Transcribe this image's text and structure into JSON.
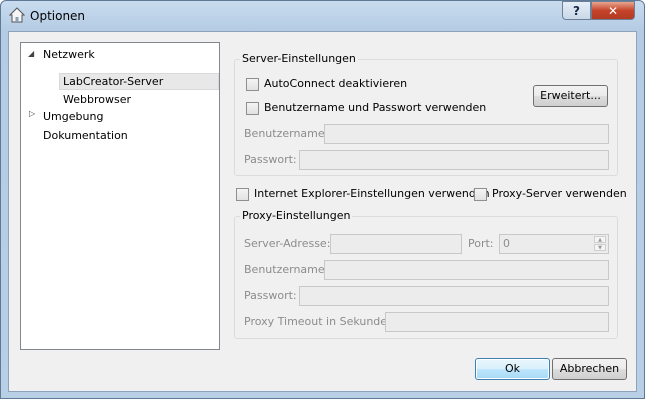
{
  "window": {
    "title": "Optionen",
    "help_label": "?",
    "close_label": "✕"
  },
  "tree": {
    "items": [
      {
        "label": "Netzwerk",
        "expanded": true
      },
      {
        "label": "LabCreator-Server",
        "selected": true
      },
      {
        "label": "Webbrowser"
      },
      {
        "label": "Umgebung",
        "expanded": false
      },
      {
        "label": "Dokumentation"
      }
    ]
  },
  "server": {
    "group_title": "Server-Einstellungen",
    "autoconnect_label": "AutoConnect deaktivieren",
    "autoconnect_checked": false,
    "credentials_label": "Benutzername und Passwort verwenden",
    "credentials_checked": false,
    "advanced_button": "Erweitert...",
    "username_label": "Benutzername:",
    "username_value": "",
    "password_label": "Passwort:",
    "password_value": ""
  },
  "ie_settings": {
    "label": "Internet Explorer-Einstellungen verwenden",
    "checked": false
  },
  "proxy_server": {
    "label": "Proxy-Server verwenden",
    "checked": false
  },
  "proxy": {
    "group_title": "Proxy-Einstellungen",
    "address_label": "Server-Adresse:",
    "address_value": "",
    "port_label": "Port:",
    "port_value": "0",
    "username_label": "Benutzername:",
    "username_value": "",
    "password_label": "Passwort:",
    "password_value": "",
    "timeout_label": "Proxy Timeout in Sekunden:",
    "timeout_value": ""
  },
  "footer": {
    "ok_label": "Ok",
    "cancel_label": "Abbrechen"
  },
  "colors": {
    "accent": "#3c7fb1",
    "close": "#c5442a",
    "disabled_text": "#8c8c8c"
  }
}
